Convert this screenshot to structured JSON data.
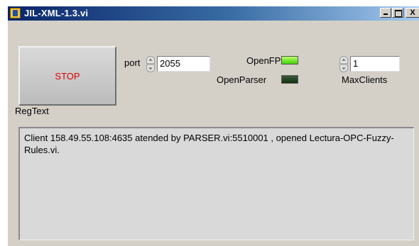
{
  "window": {
    "title": "JIL-XML-1.3.vi",
    "icon": "labview-vi-icon",
    "controls": {
      "minimize": "minimize-icon",
      "maximize": "maximize-icon",
      "close_label": "X"
    }
  },
  "panel": {
    "stop_button_label": "STOP",
    "port": {
      "label": "port",
      "value": "2055"
    },
    "indicators": [
      {
        "label": "OpenFP",
        "state": "on",
        "color": "#45d20a"
      },
      {
        "label": "OpenParser",
        "state": "off",
        "color": "#123212"
      }
    ],
    "max_clients": {
      "label": "MaxClients",
      "value": "1"
    },
    "regtext": {
      "label": "RegText",
      "text": "Client 158.49.55.108:4635 atended by PARSER.vi:5510001 , opened Lectura-OPC-Fuzzy-Rules.vi."
    }
  }
}
